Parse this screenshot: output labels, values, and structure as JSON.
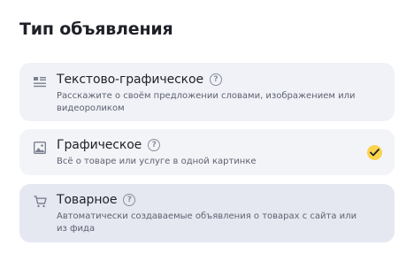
{
  "page": {
    "title": "Тип объявления"
  },
  "options": [
    {
      "title": "Текстово-графическое",
      "description": "Расскажите о своём предложении словами, изображением или видеороликом",
      "icon": "text-graphic-icon",
      "selected": false
    },
    {
      "title": "Графическое",
      "description": "Всё о товаре или услуге в одной картинке",
      "icon": "image-icon",
      "selected": true
    },
    {
      "title": "Товарное",
      "description": "Автоматически создаваемые объявления о товарах с сайта или из фида",
      "icon": "cart-icon",
      "selected": false
    }
  ],
  "help_glyph": "?",
  "colors": {
    "accent_check": "#fcd34d",
    "card_bg": "#f0f2f7",
    "card_hover_bg": "#e5e8f1"
  }
}
